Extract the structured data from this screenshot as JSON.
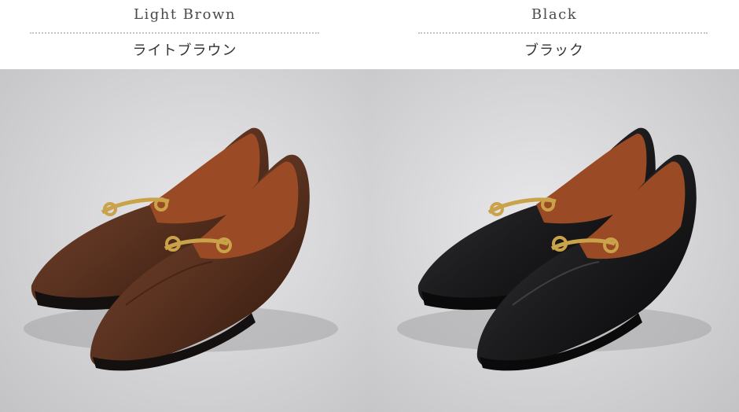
{
  "variants": [
    {
      "name_en": "Light Brown",
      "name_ja": "ライトブラウン",
      "colors": {
        "upper": "#5a3220",
        "upper_dark": "#2e160c",
        "lining": "#9a4a24",
        "hardware": "#c9a24a",
        "sole": "#141010"
      }
    },
    {
      "name_en": "Black",
      "name_ja": "ブラック",
      "colors": {
        "upper": "#1c1c1e",
        "upper_dark": "#050506",
        "lining": "#9a4a24",
        "hardware": "#c9a24a",
        "sole": "#0a0a0a"
      }
    }
  ],
  "photo_background": [
    "#c3c3c5",
    "#e7e7e9"
  ],
  "product": "horsebit-loafer-icon"
}
